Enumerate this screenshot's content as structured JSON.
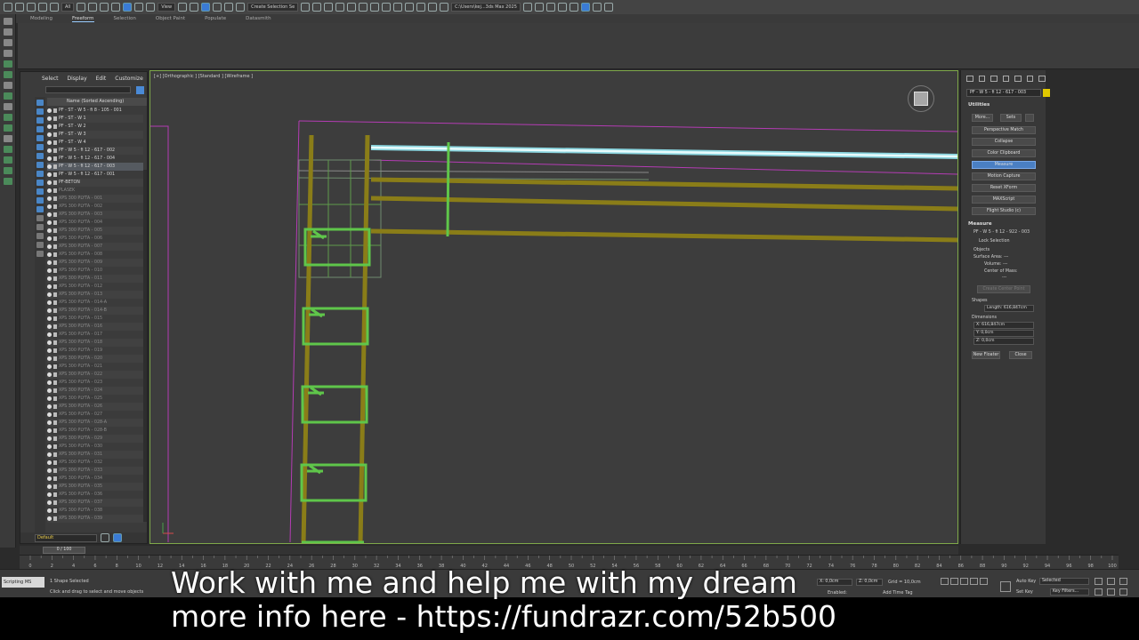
{
  "toolbar": {
    "filter_dropdown": "All",
    "view_dropdown": "View",
    "selection_set": "Create Selection Se",
    "workspace_path": "C:\\Users\\kej...3ds Max 2025"
  },
  "ribbon": {
    "tabs": [
      "Modeling",
      "Freeform",
      "Selection",
      "Object Paint",
      "Populate",
      "Datasmith"
    ],
    "active_tab": "Freeform"
  },
  "explorer": {
    "menu": [
      "Select",
      "Display",
      "Edit",
      "Customize"
    ],
    "column_header": "Name (Sorted Ascending)",
    "layer": "Default",
    "rows": [
      {
        "label": "PF - ST - W 5 - fi 8 - 105 - 001",
        "state": "normal"
      },
      {
        "label": "PF - ST - W 1",
        "state": "normal"
      },
      {
        "label": "PF - ST - W 2",
        "state": "normal"
      },
      {
        "label": "PF - ST - W 3",
        "state": "normal"
      },
      {
        "label": "PF - ST - W 4",
        "state": "normal"
      },
      {
        "label": "PF - W 5 - fi 12 - 617 - 002",
        "state": "normal"
      },
      {
        "label": "PF - W 5 - fi 12 - 617 - 004",
        "state": "normal"
      },
      {
        "label": "PF - W 5 - fi 12 - 617 - 003",
        "state": "sel"
      },
      {
        "label": "PF - W 5 - fi 12 - 617 - 001",
        "state": "normal"
      },
      {
        "label": "PF-BETON",
        "state": "normal"
      },
      {
        "label": "PLASEK",
        "state": "dim"
      },
      {
        "label": "XPS 300 PLYTA - 001",
        "state": "dim"
      },
      {
        "label": "XPS 300 PLYTA - 002",
        "state": "dim"
      },
      {
        "label": "XPS 300 PLYTA - 003",
        "state": "dim"
      },
      {
        "label": "XPS 300 PLYTA - 004",
        "state": "dim"
      },
      {
        "label": "XPS 300 PLYTA - 005",
        "state": "dim"
      },
      {
        "label": "XPS 300 PLYTA - 006",
        "state": "dim"
      },
      {
        "label": "XPS 300 PLYTA - 007",
        "state": "dim"
      },
      {
        "label": "XPS 300 PLYTA - 008",
        "state": "dim"
      },
      {
        "label": "XPS 300 PLYTA - 009",
        "state": "dim"
      },
      {
        "label": "XPS 300 PLYTA - 010",
        "state": "dim"
      },
      {
        "label": "XPS 300 PLYTA - 011",
        "state": "dim"
      },
      {
        "label": "XPS 300 PLYTA - 012",
        "state": "dim"
      },
      {
        "label": "XPS 300 PLYTA - 013",
        "state": "dim"
      },
      {
        "label": "XPS 300 PLYTA - 014-A",
        "state": "dim"
      },
      {
        "label": "XPS 300 PLYTA - 014-B",
        "state": "dim"
      },
      {
        "label": "XPS 300 PLYTA - 015",
        "state": "dim"
      },
      {
        "label": "XPS 300 PLYTA - 016",
        "state": "dim"
      },
      {
        "label": "XPS 300 PLYTA - 017",
        "state": "dim"
      },
      {
        "label": "XPS 300 PLYTA - 018",
        "state": "dim"
      },
      {
        "label": "XPS 300 PLYTA - 019",
        "state": "dim"
      },
      {
        "label": "XPS 300 PLYTA - 020",
        "state": "dim"
      },
      {
        "label": "XPS 300 PLYTA - 021",
        "state": "dim"
      },
      {
        "label": "XPS 300 PLYTA - 022",
        "state": "dim"
      },
      {
        "label": "XPS 300 PLYTA - 023",
        "state": "dim"
      },
      {
        "label": "XPS 300 PLYTA - 024",
        "state": "dim"
      },
      {
        "label": "XPS 300 PLYTA - 025",
        "state": "dim"
      },
      {
        "label": "XPS 300 PLYTA - 026",
        "state": "dim"
      },
      {
        "label": "XPS 300 PLYTA - 027",
        "state": "dim"
      },
      {
        "label": "XPS 300 PLYTA - 028-A",
        "state": "dim"
      },
      {
        "label": "XPS 300 PLYTA - 028-B",
        "state": "dim"
      },
      {
        "label": "XPS 300 PLYTA - 029",
        "state": "dim"
      },
      {
        "label": "XPS 300 PLYTA - 030",
        "state": "dim"
      },
      {
        "label": "XPS 300 PLYTA - 031",
        "state": "dim"
      },
      {
        "label": "XPS 300 PLYTA - 032",
        "state": "dim"
      },
      {
        "label": "XPS 300 PLYTA - 033",
        "state": "dim"
      },
      {
        "label": "XPS 300 PLYTA - 034",
        "state": "dim"
      },
      {
        "label": "XPS 300 PLYTA - 035",
        "state": "dim"
      },
      {
        "label": "XPS 300 PLYTA - 036",
        "state": "dim"
      },
      {
        "label": "XPS 300 PLYTA - 037",
        "state": "dim"
      },
      {
        "label": "XPS 300 PLYTA - 038",
        "state": "dim"
      },
      {
        "label": "XPS 300 PLYTA - 039",
        "state": "dim"
      }
    ]
  },
  "viewport": {
    "label": "[+] [Orthographic ] [Standard ] [Wireframe ]"
  },
  "command_panel": {
    "object_name": "PF - W 5 - fi 12 - 617 - 003",
    "utilities_title": "Utilities",
    "more_button": "More...",
    "sets_button": "Sets",
    "utilities": [
      "Perspective Match",
      "Collapse",
      "Color Clipboard",
      "Measure",
      "Motion Capture",
      "Reset XForm",
      "MAXScript",
      "Flight Studio (c)"
    ],
    "active_utility": "Measure",
    "measure": {
      "title": "Measure",
      "object": "PF - W 5 - fi 12 - 922 - 003",
      "lock_selection": "Lock Selection",
      "objects_label": "Objects",
      "surface_area": "Surface Area: ---",
      "volume": "Volume: ---",
      "center_of_mass": "Center of Mass:",
      "center_value": "---",
      "create_center_point": "Create Center Point",
      "shapes_label": "Shapes",
      "length": "Length: 616,847cm",
      "dimensions_label": "Dimensions",
      "dim_x": "X:  616,847cm",
      "dim_y": "Y:  0,0cm",
      "dim_z": "Z:  0,0cm",
      "new_floater": "New Floater",
      "close": "Close"
    }
  },
  "timeline": {
    "frame": "0 / 100",
    "ticks": [
      "0",
      "2",
      "4",
      "6",
      "8",
      "10",
      "12",
      "14",
      "16",
      "18",
      "20",
      "22",
      "24",
      "26",
      "28",
      "30",
      "32",
      "34",
      "36",
      "38",
      "40",
      "42",
      "44",
      "46",
      "48",
      "50",
      "52",
      "54",
      "56",
      "58",
      "60",
      "62",
      "64",
      "66",
      "68",
      "70",
      "72",
      "74",
      "76",
      "78",
      "80",
      "82",
      "84",
      "86",
      "88",
      "90",
      "92",
      "94",
      "96",
      "98",
      "100"
    ]
  },
  "status": {
    "script_label": "Scripting",
    "script_hint": "MS",
    "selection": "1 Shape Selected",
    "hint": "Click and drag to select and move objects",
    "x": "X: 0,0cm",
    "z": "Z: 0,0cm",
    "grid": "Grid = 10,0cm",
    "enabled": "Enabled:",
    "add_time_tag": "Add Time Tag",
    "auto_key": "Auto Key",
    "set_key": "Set Key",
    "selected": "Selected",
    "key_filters": "Key Filters..."
  },
  "caption": {
    "line1": "Work with me and help me with my dream",
    "line2": "more info here - https://fundrazr.com/52b500"
  },
  "colors": {
    "rebar": "#8a7d18",
    "stirrup": "#5fc64a",
    "selected_bar": "#cfeff2",
    "outline": "#b43cb4",
    "accent": "#4a7fc3"
  }
}
